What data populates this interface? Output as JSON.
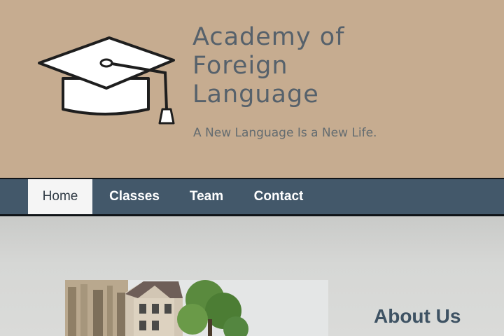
{
  "header": {
    "brand_line_1": "Academy of",
    "brand_line_2": "Foreign",
    "brand_line_3": "Language",
    "tagline": "A New Language Is a New Life."
  },
  "nav": {
    "items": [
      {
        "label": "Home",
        "active": true
      },
      {
        "label": "Classes",
        "active": false
      },
      {
        "label": "Team",
        "active": false
      },
      {
        "label": "Contact",
        "active": false
      }
    ]
  },
  "main": {
    "about_title": "About Us"
  },
  "icons": {
    "logo": "graduation-cap-icon"
  },
  "colors": {
    "header_bg": "#c6ac90",
    "nav_bg": "#43586a",
    "brand_text": "#56616b",
    "about_title": "#3e5263"
  }
}
